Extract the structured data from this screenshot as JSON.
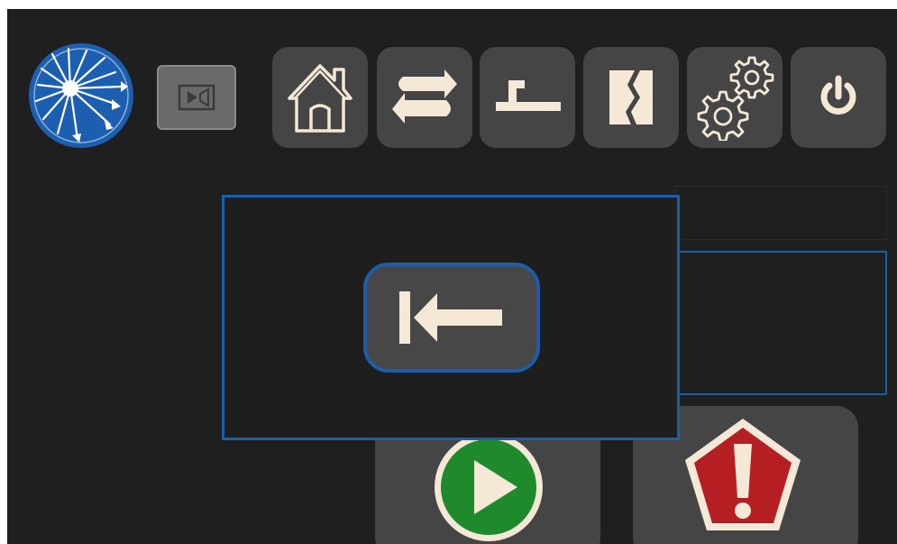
{
  "app": {
    "logo_icon": "starburst-arrows-logo",
    "camera_icon": "video-camera-icon"
  },
  "toolbar": {
    "buttons": [
      {
        "name": "home-button",
        "icon": "home-icon"
      },
      {
        "name": "swap-button",
        "icon": "swap-arrows-icon"
      },
      {
        "name": "tool-button",
        "icon": "hook-tool-icon"
      },
      {
        "name": "split-button",
        "icon": "split-panel-icon"
      },
      {
        "name": "settings-button",
        "icon": "gears-icon"
      },
      {
        "name": "power-button",
        "icon": "power-icon"
      }
    ]
  },
  "dialog": {
    "back_icon": "arrow-left-to-bar-icon"
  },
  "actions": {
    "start_icon": "play-icon",
    "alert_icon": "exclamation-pentagon-icon"
  },
  "colors": {
    "background": "#1f1f1f",
    "button": "#454545",
    "accent_blue": "#1d5ea8",
    "icon_cream": "#f5e8d6",
    "play_green": "#1f8a2c",
    "alert_red": "#b51e22"
  }
}
